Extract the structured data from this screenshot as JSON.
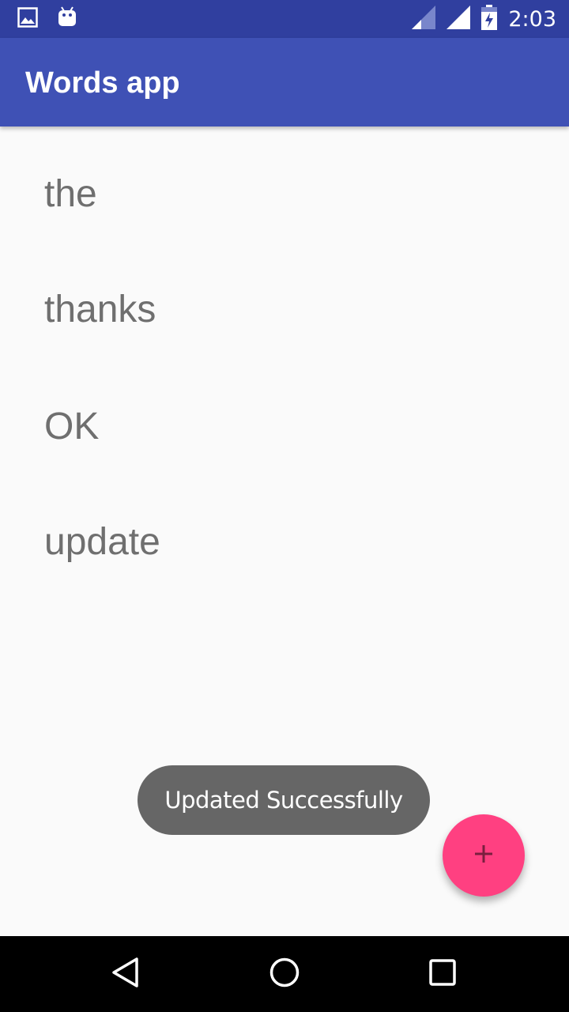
{
  "status_bar": {
    "time": "2:03",
    "icons": [
      "image-icon",
      "android-icon",
      "signal-icon",
      "signal-full-icon",
      "battery-charging-icon"
    ]
  },
  "app_bar": {
    "title": "Words app"
  },
  "words": [
    "the",
    "thanks",
    "OK",
    "update"
  ],
  "toast": {
    "message": "Updated Successfully"
  },
  "fab": {
    "icon": "plus-icon"
  },
  "nav_bar": {
    "icons": [
      "back-icon",
      "home-icon",
      "recents-icon"
    ]
  },
  "colors": {
    "primary": "#3f51b5",
    "primary_dark": "#303f9f",
    "accent": "#ff4081",
    "word_text": "#6f6f6f",
    "toast_bg": "#666666"
  }
}
